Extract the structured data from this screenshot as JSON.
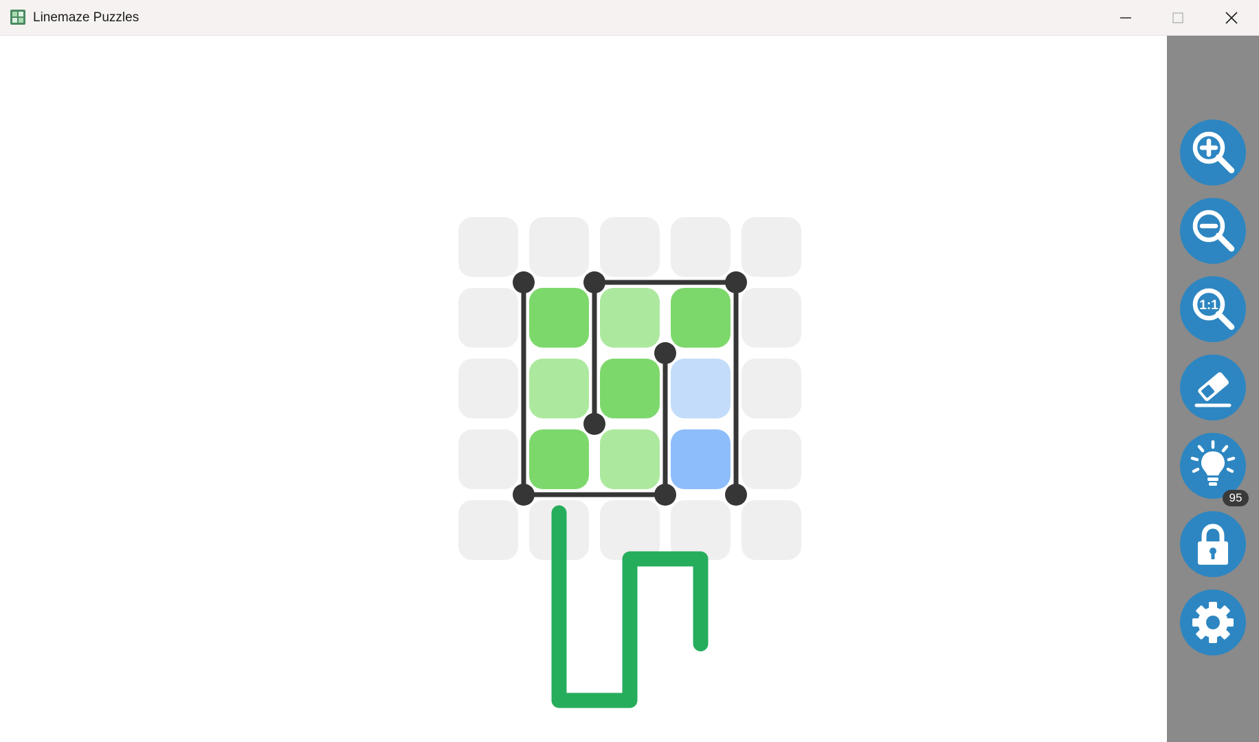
{
  "window": {
    "title": "Linemaze Puzzles"
  },
  "toolbar": {
    "buttons": [
      {
        "name": "zoom-in-button",
        "icon": "zoom-in-icon"
      },
      {
        "name": "zoom-out-button",
        "icon": "zoom-out-icon"
      },
      {
        "name": "zoom-reset-button",
        "icon": "zoom-1to1-icon",
        "label": "1:1"
      },
      {
        "name": "eraser-button",
        "icon": "eraser-icon"
      },
      {
        "name": "hint-button",
        "icon": "lightbulb-icon",
        "badge": "95"
      },
      {
        "name": "lock-button",
        "icon": "lock-icon"
      },
      {
        "name": "settings-button",
        "icon": "gear-icon"
      }
    ]
  },
  "puzzle": {
    "rows": 5,
    "cols": 5,
    "cells": [
      [
        "empty",
        "empty",
        "empty",
        "empty",
        "empty"
      ],
      [
        "empty",
        "green",
        "light-green",
        "green",
        "empty"
      ],
      [
        "empty",
        "light-green",
        "green",
        "light-blue",
        "empty"
      ],
      [
        "empty",
        "green",
        "light-green",
        "blue",
        "empty"
      ],
      [
        "empty",
        "empty",
        "empty",
        "empty",
        "empty"
      ]
    ],
    "walls": [
      {
        "from": [
          1,
          1
        ],
        "to": [
          4,
          1
        ]
      },
      {
        "from": [
          4,
          1
        ],
        "to": [
          4,
          3
        ]
      },
      {
        "from": [
          1,
          2
        ],
        "to": [
          3,
          2
        ]
      },
      {
        "from": [
          1,
          2
        ],
        "to": [
          1,
          4
        ]
      },
      {
        "from": [
          1,
          4
        ],
        "to": [
          4,
          4
        ]
      },
      {
        "from": [
          2,
          3
        ],
        "to": [
          4,
          3
        ]
      }
    ],
    "dots": [
      [
        1,
        1
      ],
      [
        1,
        2
      ],
      [
        1,
        4
      ],
      [
        2,
        3
      ],
      [
        3,
        2
      ],
      [
        4,
        1
      ],
      [
        4,
        3
      ],
      [
        4,
        4
      ]
    ],
    "path_cells": [
      [
        0.35,
        1
      ],
      [
        3,
        1
      ],
      [
        3,
        2
      ],
      [
        1,
        2
      ],
      [
        1,
        3
      ],
      [
        2.2,
        3
      ]
    ],
    "colors": {
      "empty": "#efefef",
      "green": "#7dd86c",
      "light-green": "#ace99e",
      "light-blue": "#c3dcfa",
      "blue": "#8ebdfb",
      "path": "#26ad5c",
      "wall": "#363636",
      "accent": "#2d86c1",
      "toolbar_bg": "#8a8a8a"
    }
  }
}
